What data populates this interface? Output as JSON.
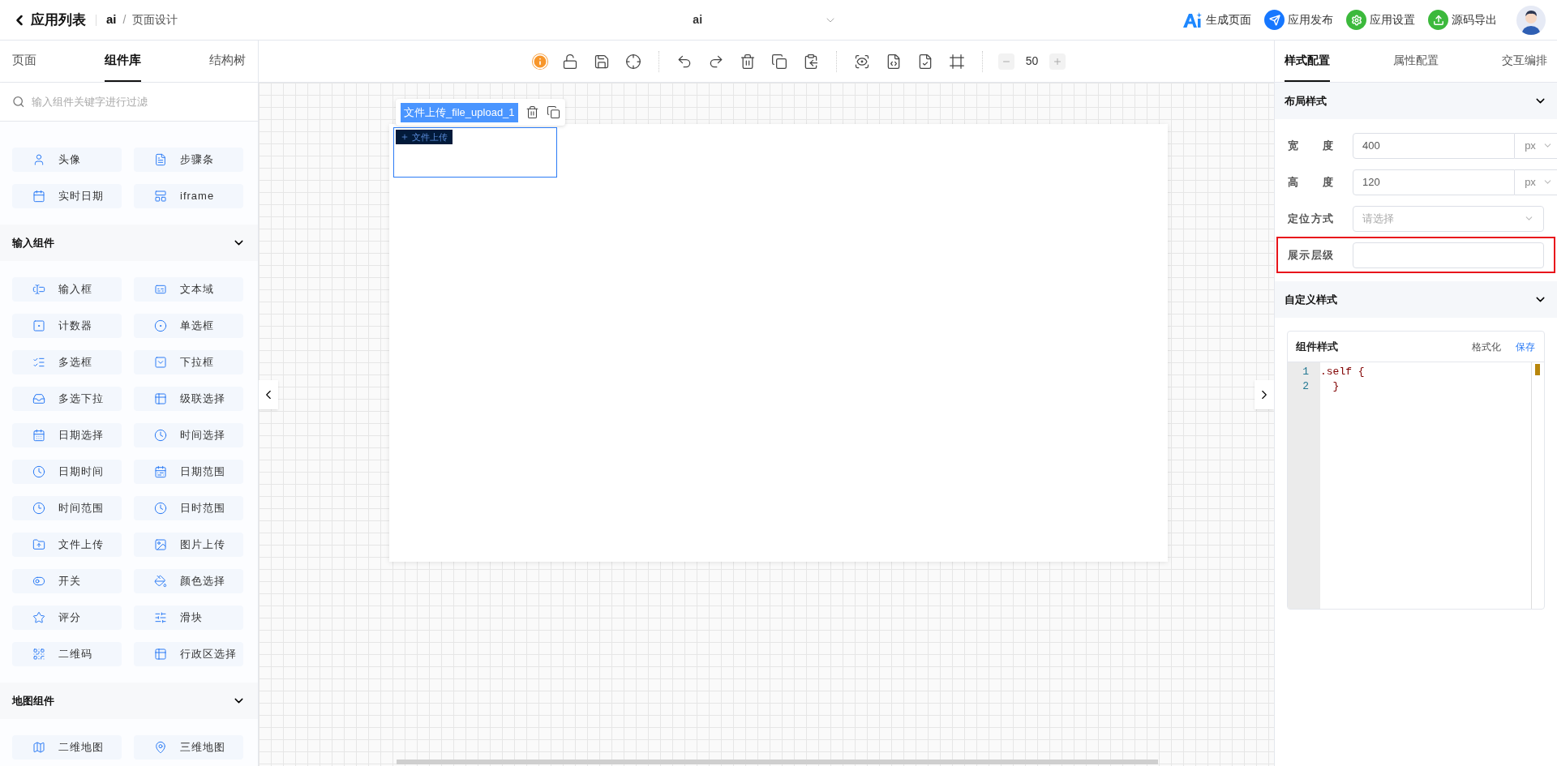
{
  "header": {
    "back_label": "应用列表",
    "app": "ai",
    "separator": "/",
    "page": "页面设计",
    "center_title": "ai",
    "actions": [
      {
        "label": "生成页面",
        "color": "#1e88ff"
      },
      {
        "label": "应用发布",
        "color": "#1677ff"
      },
      {
        "label": "应用设置",
        "color": "#3cb93c"
      },
      {
        "label": "源码导出",
        "color": "#3cb93c"
      }
    ]
  },
  "left_panel": {
    "tabs": [
      {
        "label": "页面",
        "selected": false
      },
      {
        "label": "组件库",
        "selected": true
      },
      {
        "label": "结构树",
        "selected": false
      }
    ],
    "search": {
      "placeholder": "输入组件关键字进行过滤"
    },
    "sections": [
      {
        "items": [
          "头像",
          "步骤条",
          "实时日期",
          "iframe"
        ]
      },
      {
        "title": "输入组件",
        "expanded": true,
        "items": [
          "输入框",
          "文本域",
          "计数器",
          "单选框",
          "多选框",
          "下拉框",
          "多选下拉",
          "级联选择",
          "日期选择",
          "时间选择",
          "日期时间",
          "日期范围",
          "时间范围",
          "日时范围",
          "文件上传",
          "图片上传",
          "开关",
          "颜色选择",
          "评分",
          "滑块",
          "二维码",
          "行政区选择"
        ]
      },
      {
        "title": "地图组件",
        "expanded": true,
        "items": [
          "二维地图",
          "三维地图"
        ]
      }
    ]
  },
  "toolbar": {
    "zoom": "50"
  },
  "canvas": {
    "selected_label": "文件上传_file_upload_1",
    "upload_button": "文件上传"
  },
  "right_panel": {
    "tabs": [
      {
        "label": "样式配置",
        "selected": true
      },
      {
        "label": "属性配置",
        "selected": false
      },
      {
        "label": "交互编排",
        "selected": false
      }
    ],
    "sections": [
      {
        "title": "布局样式",
        "expanded": true,
        "fields": [
          {
            "kind": "unit",
            "label": "宽度",
            "value": "400",
            "unit": "px",
            "highlighted": false
          },
          {
            "kind": "unit",
            "label": "高度",
            "value": "120",
            "unit": "px",
            "highlighted": false
          },
          {
            "kind": "select",
            "label": "定位方式",
            "placeholder": "请选择",
            "highlighted": false
          },
          {
            "kind": "input",
            "label": "展示层级",
            "highlighted": true
          }
        ]
      },
      {
        "title": "自定义样式",
        "expanded": true,
        "editor": {
          "title": "组件样式",
          "actions": [
            "格式化",
            "保存"
          ],
          "lines": [
            {
              "number": "1",
              "code": ".self {"
            },
            {
              "number": "2",
              "code": "  }"
            }
          ]
        }
      }
    ]
  }
}
